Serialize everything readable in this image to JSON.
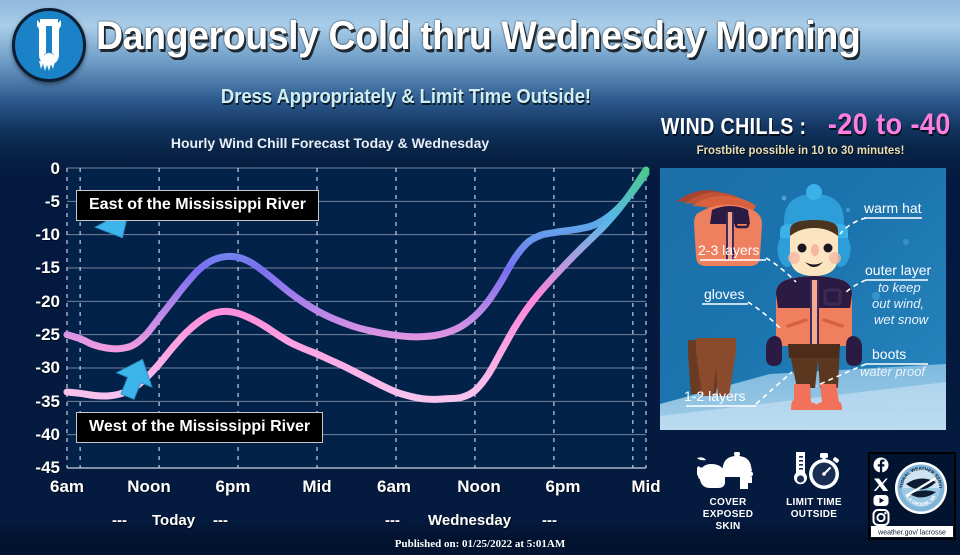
{
  "header": {
    "logo_icon": "thermometer-icicle-icon",
    "title": "Dangerously Cold thru Wednesday Morning",
    "subtitle": "Dress Appropriately & Limit Time Outside!"
  },
  "wind_chill_callout": {
    "label": "WIND CHILLS :",
    "value": "-20 to -40",
    "value_color": "#ff7fe0",
    "note": "Frostbite possible in 10 to 30 minutes!"
  },
  "chart_data": {
    "type": "line",
    "title": "Hourly Wind Chill Forecast Today & Wednesday",
    "xlabel": "",
    "ylabel": "",
    "ylim": [
      -45,
      0
    ],
    "yticks": [
      "0",
      "-5",
      "-10",
      "-15",
      "-20",
      "-25",
      "-30",
      "-35",
      "-40",
      "-45"
    ],
    "ytick_values": [
      0,
      -5,
      -10,
      -15,
      -20,
      -25,
      -30,
      -35,
      -40,
      -45
    ],
    "xticks": [
      "6am",
      "Noon",
      "6pm",
      "Mid",
      "6am",
      "Noon",
      "6pm",
      "Mid"
    ],
    "xtick_hours": [
      6,
      12,
      18,
      24,
      30,
      36,
      42,
      48
    ],
    "xlim": [
      5,
      49
    ],
    "grid": true,
    "legend_position": "inline-callouts",
    "day_bands": [
      {
        "label": "Today",
        "prefix": "---",
        "suffix": "---"
      },
      {
        "label": "Wednesday",
        "prefix": "---",
        "suffix": "---"
      }
    ],
    "series": [
      {
        "name": "East of the Mississippi River",
        "x": [
          5,
          6,
          7,
          8,
          9,
          10,
          11,
          12,
          13,
          14,
          15,
          16,
          17,
          18,
          19,
          20,
          21,
          22,
          23,
          24,
          25,
          26,
          27,
          28,
          29,
          30,
          31,
          32,
          33,
          34,
          35,
          36,
          37,
          38,
          39,
          40,
          41,
          42,
          43,
          44,
          45,
          46,
          47,
          48,
          49
        ],
        "values": [
          -25,
          -25.6,
          -26.5,
          -27,
          -27.1,
          -26.6,
          -25,
          -22.5,
          -20,
          -17.5,
          -15.3,
          -13.9,
          -13.3,
          -13.4,
          -14.2,
          -15.6,
          -17.2,
          -18.8,
          -20.2,
          -21.4,
          -22.4,
          -23.2,
          -23.9,
          -24.4,
          -24.8,
          -25.1,
          -25.3,
          -25.3,
          -25.1,
          -24.6,
          -23.7,
          -22.2,
          -20,
          -17,
          -13.6,
          -11.2,
          -10.1,
          -9.7,
          -9.4,
          -9.1,
          -8.6,
          -7.5,
          -5.8,
          -3.5,
          -0.8
        ],
        "color_start": "#f09ce0",
        "color_mid": "#7b6ff0",
        "color_end": "#3fbf84"
      },
      {
        "name": "West of the Mississippi River",
        "x": [
          5,
          6,
          7,
          8,
          9,
          10,
          11,
          12,
          13,
          14,
          15,
          16,
          17,
          18,
          19,
          20,
          21,
          22,
          23,
          24,
          25,
          26,
          27,
          28,
          29,
          30,
          31,
          32,
          33,
          34,
          35,
          36,
          37,
          38,
          39,
          40,
          41,
          42,
          43,
          44,
          45,
          46,
          47,
          48,
          49
        ],
        "values": [
          -33.6,
          -33.8,
          -34.1,
          -34.2,
          -33.9,
          -33.1,
          -31.5,
          -29.4,
          -27,
          -24.8,
          -23.1,
          -21.9,
          -21.5,
          -21.8,
          -22.6,
          -23.7,
          -25,
          -26.2,
          -27.1,
          -27.9,
          -28.8,
          -29.7,
          -30.7,
          -31.7,
          -32.7,
          -33.6,
          -34.2,
          -34.6,
          -34.7,
          -34.6,
          -34.4,
          -33.4,
          -31,
          -27.5,
          -24,
          -21,
          -18.5,
          -16.3,
          -14.2,
          -12.2,
          -10.3,
          -8.3,
          -6,
          -3.3,
          -0.3
        ],
        "color_start": "#f7c4ee",
        "color_mid": "#ff85d8",
        "color_end": "#4cc98c"
      }
    ],
    "annotations": [
      {
        "text": "East of the Mississippi River",
        "points_to": "East of the Mississippi River",
        "arrow": "down-right-arrow"
      },
      {
        "text": "West of the Mississippi River",
        "points_to": "West of the Mississippi River",
        "arrow": "up-right-arrow"
      }
    ]
  },
  "infographic": {
    "labels": {
      "warm_hat": "warm hat",
      "layers_top": "2-3 layers",
      "gloves": "gloves",
      "outer_layer": "outer layer",
      "outer_layer_detail_1": "to keep",
      "outer_layer_detail_2": "out wind,",
      "outer_layer_detail_3": "wet snow",
      "boots": "boots",
      "boots_detail": "water proof",
      "layers_bottom": "1-2 layers"
    }
  },
  "advice_icons": [
    {
      "icon": "mittens-hat-scarf-icon",
      "line1": "COVER",
      "line2": "EXPOSED",
      "line3": "SKIN"
    },
    {
      "icon": "thermometer-stopwatch-icon",
      "line1": "LIMIT TIME",
      "line2": "OUTSIDE",
      "line3": ""
    }
  ],
  "nws_box": {
    "social_icons": [
      "facebook-icon",
      "twitter-icon",
      "youtube-icon",
      "instagram-icon"
    ],
    "seal_top_text": "NATIONAL WEATHER SERVICE",
    "seal_bottom_text": "LA CROSSE, WI",
    "website": "weather.gov/ lacrosse"
  },
  "footer": {
    "published": "Published on: 01/25/2022 at 5:01AM"
  }
}
